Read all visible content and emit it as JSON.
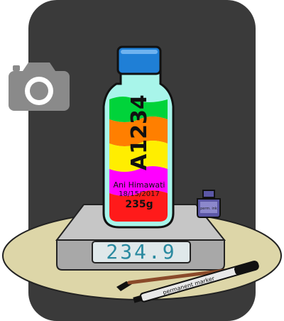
{
  "bottle": {
    "code": "A1234",
    "name": "Ani Himawati",
    "date": "18/15/2017",
    "weight": "235g",
    "layer_colors": [
      "#00d33a",
      "#ff7f00",
      "#ffee00",
      "#ff00ff",
      "#ff1a1a"
    ],
    "cap_color": "#1f7fd6",
    "glass_color": "#a8f5ea"
  },
  "scale": {
    "reading": "234.9",
    "display_color": "#dfe8ea",
    "digit_color": "#2a8aa0"
  },
  "ink_bottle": {
    "label": "perm. ink"
  },
  "marker": {
    "label": "permanent marker"
  },
  "icons": {
    "camera": "camera-icon"
  },
  "colors": {
    "backdrop": "#3a3a3a",
    "table": "#ddd6a8"
  }
}
